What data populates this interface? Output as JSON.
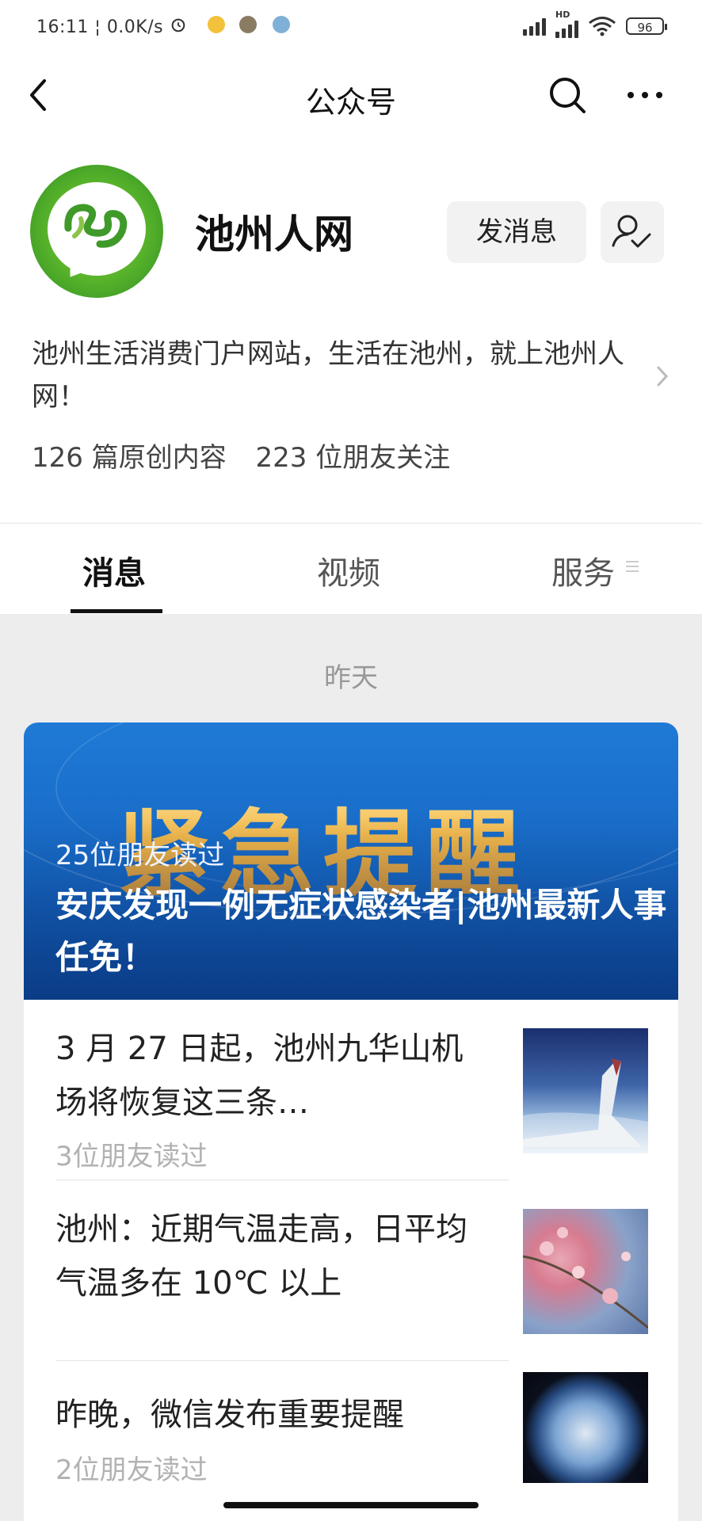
{
  "status_bar": {
    "time": "16:11",
    "speed": "0.0K/s",
    "network": "HD",
    "battery": "96"
  },
  "nav": {
    "title": "公众号"
  },
  "profile": {
    "name": "池州人网",
    "message_button": "发消息",
    "description": "池州生活消费门户网站，生活在池州，就上池州人网！",
    "original_count": "126 篇原创内容",
    "followers": "223 位朋友关注"
  },
  "tabs": [
    {
      "label": "消息"
    },
    {
      "label": "视频"
    },
    {
      "label": "服务"
    }
  ],
  "feed": {
    "date_label": "昨天",
    "hero": {
      "image_text": "紧急提醒",
      "reads": "25位朋友读过",
      "title": "安庆发现一例无症状感染者|池州最新人事任免！"
    },
    "articles": [
      {
        "title": "3 月 27 日起，池州九华山机场将恢复这三条…",
        "reads": "3位朋友读过"
      },
      {
        "title": "池州：近期气温走高，日平均气温多在 10℃ 以上",
        "reads": ""
      },
      {
        "title": "昨晚，微信发布重要提醒",
        "reads": "2位朋友读过"
      }
    ]
  },
  "colors": {
    "accent_green": "#55b12a",
    "hero_blue": "#1667c2",
    "hero_gold": "#f3b746"
  }
}
